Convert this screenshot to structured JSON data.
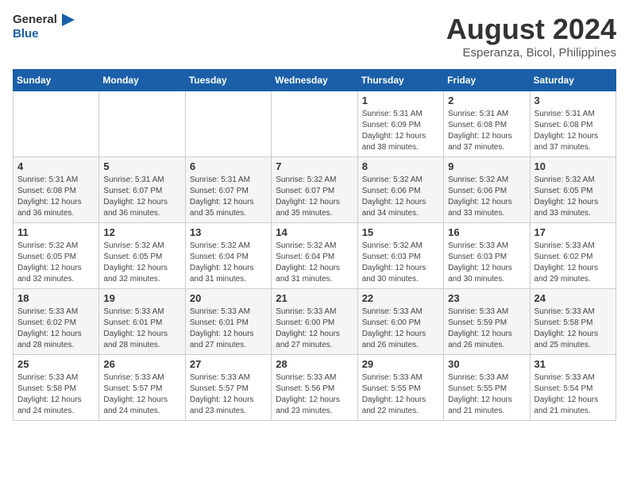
{
  "header": {
    "logo_line1": "General",
    "logo_line2": "Blue",
    "month_year": "August 2024",
    "location": "Esperanza, Bicol, Philippines"
  },
  "days_of_week": [
    "Sunday",
    "Monday",
    "Tuesday",
    "Wednesday",
    "Thursday",
    "Friday",
    "Saturday"
  ],
  "weeks": [
    [
      {
        "day": "",
        "sunrise": "",
        "sunset": "",
        "daylight": ""
      },
      {
        "day": "",
        "sunrise": "",
        "sunset": "",
        "daylight": ""
      },
      {
        "day": "",
        "sunrise": "",
        "sunset": "",
        "daylight": ""
      },
      {
        "day": "",
        "sunrise": "",
        "sunset": "",
        "daylight": ""
      },
      {
        "day": "1",
        "sunrise": "5:31 AM",
        "sunset": "6:09 PM",
        "daylight": "12 hours and 38 minutes."
      },
      {
        "day": "2",
        "sunrise": "5:31 AM",
        "sunset": "6:08 PM",
        "daylight": "12 hours and 37 minutes."
      },
      {
        "day": "3",
        "sunrise": "5:31 AM",
        "sunset": "6:08 PM",
        "daylight": "12 hours and 37 minutes."
      }
    ],
    [
      {
        "day": "4",
        "sunrise": "5:31 AM",
        "sunset": "6:08 PM",
        "daylight": "12 hours and 36 minutes."
      },
      {
        "day": "5",
        "sunrise": "5:31 AM",
        "sunset": "6:07 PM",
        "daylight": "12 hours and 36 minutes."
      },
      {
        "day": "6",
        "sunrise": "5:31 AM",
        "sunset": "6:07 PM",
        "daylight": "12 hours and 35 minutes."
      },
      {
        "day": "7",
        "sunrise": "5:32 AM",
        "sunset": "6:07 PM",
        "daylight": "12 hours and 35 minutes."
      },
      {
        "day": "8",
        "sunrise": "5:32 AM",
        "sunset": "6:06 PM",
        "daylight": "12 hours and 34 minutes."
      },
      {
        "day": "9",
        "sunrise": "5:32 AM",
        "sunset": "6:06 PM",
        "daylight": "12 hours and 33 minutes."
      },
      {
        "day": "10",
        "sunrise": "5:32 AM",
        "sunset": "6:05 PM",
        "daylight": "12 hours and 33 minutes."
      }
    ],
    [
      {
        "day": "11",
        "sunrise": "5:32 AM",
        "sunset": "6:05 PM",
        "daylight": "12 hours and 32 minutes."
      },
      {
        "day": "12",
        "sunrise": "5:32 AM",
        "sunset": "6:05 PM",
        "daylight": "12 hours and 32 minutes."
      },
      {
        "day": "13",
        "sunrise": "5:32 AM",
        "sunset": "6:04 PM",
        "daylight": "12 hours and 31 minutes."
      },
      {
        "day": "14",
        "sunrise": "5:32 AM",
        "sunset": "6:04 PM",
        "daylight": "12 hours and 31 minutes."
      },
      {
        "day": "15",
        "sunrise": "5:32 AM",
        "sunset": "6:03 PM",
        "daylight": "12 hours and 30 minutes."
      },
      {
        "day": "16",
        "sunrise": "5:33 AM",
        "sunset": "6:03 PM",
        "daylight": "12 hours and 30 minutes."
      },
      {
        "day": "17",
        "sunrise": "5:33 AM",
        "sunset": "6:02 PM",
        "daylight": "12 hours and 29 minutes."
      }
    ],
    [
      {
        "day": "18",
        "sunrise": "5:33 AM",
        "sunset": "6:02 PM",
        "daylight": "12 hours and 28 minutes."
      },
      {
        "day": "19",
        "sunrise": "5:33 AM",
        "sunset": "6:01 PM",
        "daylight": "12 hours and 28 minutes."
      },
      {
        "day": "20",
        "sunrise": "5:33 AM",
        "sunset": "6:01 PM",
        "daylight": "12 hours and 27 minutes."
      },
      {
        "day": "21",
        "sunrise": "5:33 AM",
        "sunset": "6:00 PM",
        "daylight": "12 hours and 27 minutes."
      },
      {
        "day": "22",
        "sunrise": "5:33 AM",
        "sunset": "6:00 PM",
        "daylight": "12 hours and 26 minutes."
      },
      {
        "day": "23",
        "sunrise": "5:33 AM",
        "sunset": "5:59 PM",
        "daylight": "12 hours and 26 minutes."
      },
      {
        "day": "24",
        "sunrise": "5:33 AM",
        "sunset": "5:58 PM",
        "daylight": "12 hours and 25 minutes."
      }
    ],
    [
      {
        "day": "25",
        "sunrise": "5:33 AM",
        "sunset": "5:58 PM",
        "daylight": "12 hours and 24 minutes."
      },
      {
        "day": "26",
        "sunrise": "5:33 AM",
        "sunset": "5:57 PM",
        "daylight": "12 hours and 24 minutes."
      },
      {
        "day": "27",
        "sunrise": "5:33 AM",
        "sunset": "5:57 PM",
        "daylight": "12 hours and 23 minutes."
      },
      {
        "day": "28",
        "sunrise": "5:33 AM",
        "sunset": "5:56 PM",
        "daylight": "12 hours and 23 minutes."
      },
      {
        "day": "29",
        "sunrise": "5:33 AM",
        "sunset": "5:55 PM",
        "daylight": "12 hours and 22 minutes."
      },
      {
        "day": "30",
        "sunrise": "5:33 AM",
        "sunset": "5:55 PM",
        "daylight": "12 hours and 21 minutes."
      },
      {
        "day": "31",
        "sunrise": "5:33 AM",
        "sunset": "5:54 PM",
        "daylight": "12 hours and 21 minutes."
      }
    ]
  ],
  "labels": {
    "sunrise_prefix": "Sunrise: ",
    "sunset_prefix": "Sunset: ",
    "daylight_prefix": "Daylight: "
  }
}
